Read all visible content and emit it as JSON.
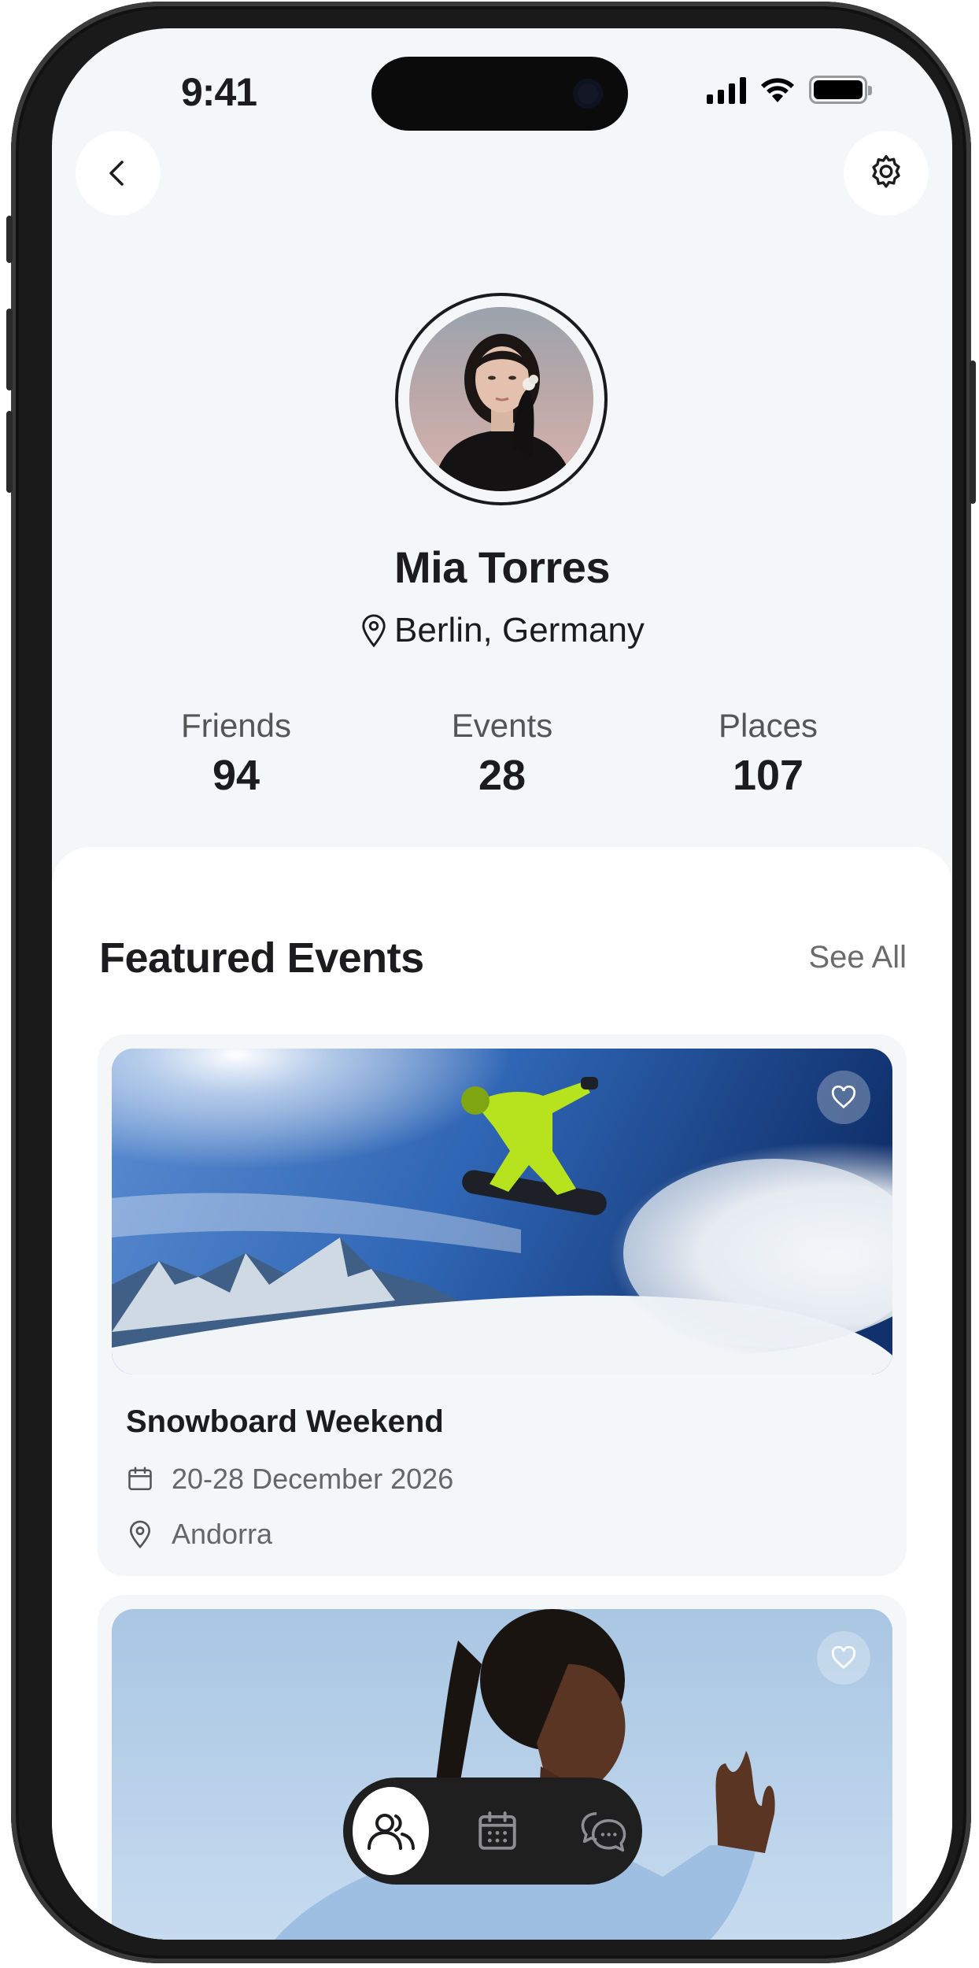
{
  "status_bar": {
    "time": "9:41"
  },
  "header": {
    "back_icon": "chevron-left-icon",
    "settings_icon": "gear-icon"
  },
  "profile": {
    "name": "Mia Torres",
    "location": "Berlin, Germany",
    "stats": [
      {
        "label": "Friends",
        "value": "94"
      },
      {
        "label": "Events",
        "value": "28"
      },
      {
        "label": "Places",
        "value": "107"
      }
    ]
  },
  "featured": {
    "title": "Featured Events",
    "see_all": "See All",
    "events": [
      {
        "title": "Snowboard Weekend",
        "date": "20-28 December 2026",
        "location": "Andorra"
      },
      {
        "title": "",
        "date": "",
        "location": ""
      }
    ]
  },
  "tabbar": {
    "tabs": [
      {
        "icon": "users-icon",
        "active": true
      },
      {
        "icon": "calendar-icon",
        "active": false
      },
      {
        "icon": "chat-icon",
        "active": false
      }
    ]
  },
  "colors": {
    "background": "#f5f6f8",
    "text": "#1c1c1e",
    "muted": "#6b6b6b",
    "tabbar": "#1f1f1f"
  }
}
